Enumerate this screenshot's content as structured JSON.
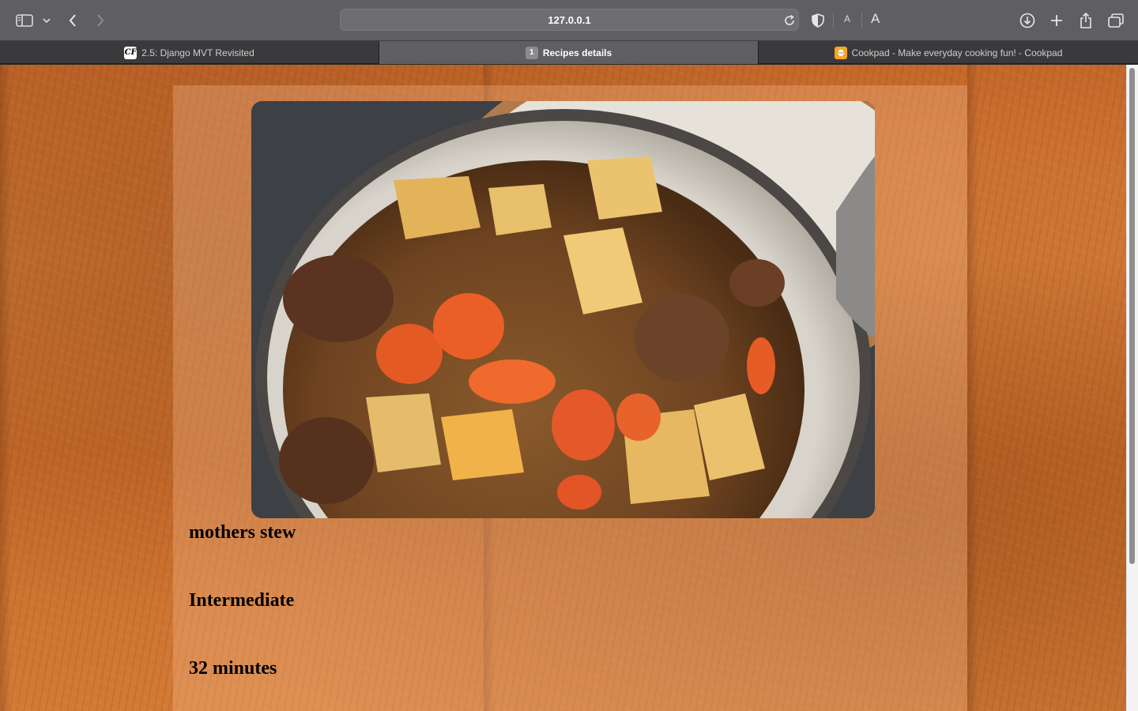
{
  "browser": {
    "url": "127.0.0.1",
    "tabs": [
      {
        "label": "2.5: Django MVT Revisited",
        "favicon": "CF"
      },
      {
        "label": "Recipes details",
        "favicon": "1"
      },
      {
        "label": "Cookpad - Make everyday cooking fun! - Cookpad",
        "favicon": "cookpad-icon"
      }
    ],
    "font_small": "A",
    "font_large": "A"
  },
  "recipe": {
    "name": "mothers stew",
    "difficulty": "Intermediate",
    "cooking_time": "32 minutes"
  },
  "colors": {
    "chrome": "#5f5e63",
    "wood": "#c96e2e"
  }
}
